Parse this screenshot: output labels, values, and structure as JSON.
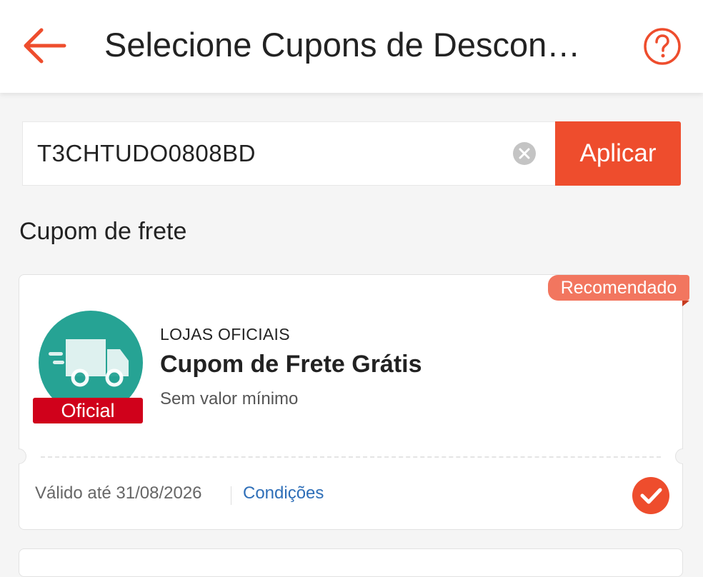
{
  "header": {
    "title": "Selecione Cupons de Descon…",
    "back_icon": "arrow-left-icon",
    "help_icon": "question-circle-icon"
  },
  "search": {
    "value": "T3CHTUDO0808BD",
    "clear_icon": "clear-circle-icon",
    "apply_label": "Aplicar"
  },
  "section": {
    "title": "Cupom de frete"
  },
  "coupon": {
    "badge": "Recomendado",
    "logo_icon": "delivery-truck-icon",
    "logo_tag": "Oficial",
    "tagline": "LOJAS OFICIAIS",
    "title": "Cupom de Frete Grátis",
    "minimum": "Sem valor mínimo",
    "validity": "Válido até 31/08/2026",
    "conditions_label": "Condições",
    "selected": true,
    "check_icon": "checkmark-icon"
  },
  "colors": {
    "accent": "#ee4d2d",
    "badge": "#f2765f",
    "logo_bg": "#26a394",
    "official_tag": "#d0011b",
    "link": "#2f6fb8"
  }
}
